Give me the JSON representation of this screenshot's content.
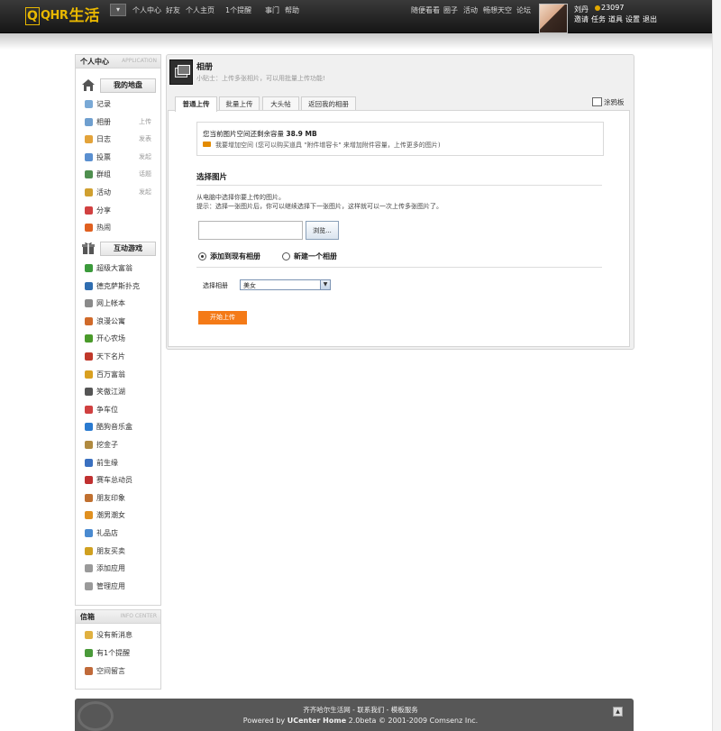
{
  "header": {
    "logo": {
      "q": "Q",
      "qhr": "QHR",
      "cn": "生活"
    },
    "menu_toggle": "▾",
    "nav_left": [
      "个人中心",
      "好友",
      "个人主页",
      "1个提醒",
      "事门",
      "帮助"
    ],
    "nav_right": [
      "随便看看",
      "圈子",
      "活动",
      "畅想天空",
      "论坛"
    ],
    "user": {
      "name": "刘丹",
      "points": "23097",
      "links": [
        "邀请",
        "任务",
        "道具",
        "设置",
        "退出"
      ]
    }
  },
  "sidebar": {
    "title": "个人中心",
    "subtitle": "APPLICATION",
    "section_mine": "我的地盘",
    "items": [
      {
        "label": "记录",
        "action": "",
        "icon": "record-icon",
        "color": "#7aa9d6"
      },
      {
        "label": "相册",
        "action": "上传",
        "icon": "album-icon",
        "color": "#6f9fcf"
      },
      {
        "label": "日志",
        "action": "发表",
        "icon": "blog-icon",
        "color": "#e3a33a"
      },
      {
        "label": "投票",
        "action": "发起",
        "icon": "poll-icon",
        "color": "#5a8fd0"
      },
      {
        "label": "群组",
        "action": "话题",
        "icon": "group-icon",
        "color": "#4f8f4f"
      },
      {
        "label": "活动",
        "action": "发起",
        "icon": "event-icon",
        "color": "#d0a030"
      },
      {
        "label": "分享",
        "action": "",
        "icon": "share-icon",
        "color": "#d14040"
      },
      {
        "label": "热闹",
        "action": "",
        "icon": "hot-icon",
        "color": "#e06020"
      }
    ],
    "section_games": "互动游戏",
    "games": [
      {
        "label": "超级大富翁",
        "icon": "monopoly-icon",
        "color": "#3b9a3b"
      },
      {
        "label": "德克萨斯扑克",
        "icon": "poker-icon",
        "color": "#2f6db0"
      },
      {
        "label": "网上帐本",
        "icon": "ledger-icon",
        "color": "#8a8a8a"
      },
      {
        "label": "浪漫公寓",
        "icon": "apartment-icon",
        "color": "#d06a2a"
      },
      {
        "label": "开心农场",
        "icon": "farm-icon",
        "color": "#4a9a2a"
      },
      {
        "label": "天下名片",
        "icon": "card-icon",
        "color": "#c0382a"
      },
      {
        "label": "百万富翁",
        "icon": "millionaire-icon",
        "color": "#d9a020"
      },
      {
        "label": "笑傲江湖",
        "icon": "sword-icon",
        "color": "#555555"
      },
      {
        "label": "争车位",
        "icon": "parking-icon",
        "color": "#d04040"
      },
      {
        "label": "酷狗音乐盒",
        "icon": "music-icon",
        "color": "#2a7ad0"
      },
      {
        "label": "挖金子",
        "icon": "gold-icon",
        "color": "#b08a40"
      },
      {
        "label": "前生缘",
        "icon": "fate-icon",
        "color": "#3a70c0"
      },
      {
        "label": "赛车总动员",
        "icon": "racing-icon",
        "color": "#c03030"
      },
      {
        "label": "朋友印象",
        "icon": "impression-icon",
        "color": "#c07030"
      },
      {
        "label": "潮男潮女",
        "icon": "fashion-icon",
        "color": "#e09020"
      },
      {
        "label": "礼品店",
        "icon": "gift-shop-icon",
        "color": "#4a8ad0"
      },
      {
        "label": "朋友买卖",
        "icon": "trade-icon",
        "color": "#d0a020"
      },
      {
        "label": "添加应用",
        "icon": "add-app-icon",
        "color": "#9a9a9a"
      },
      {
        "label": "管理应用",
        "icon": "manage-app-icon",
        "color": "#9a9a9a"
      }
    ]
  },
  "inbox": {
    "title": "信箱",
    "subtitle": "INFO CENTER",
    "items": [
      {
        "label": "没有新消息",
        "icon": "mail-icon",
        "color": "#e0b040"
      },
      {
        "label": "有1个提醒",
        "icon": "notice-icon",
        "color": "#4a9a3a"
      },
      {
        "label": "空间留言",
        "icon": "guestbook-icon",
        "color": "#c06a3a"
      }
    ]
  },
  "main": {
    "title": "相册",
    "tip": "小贴士：上传多张相片，可以用批量上传功能!",
    "tabs": [
      "普通上传",
      "批量上传",
      "大头帖",
      "返回我的相册"
    ],
    "graffiti": "涂鸦板",
    "quota_prefix": "您当前图片空间还剩余容量",
    "quota_value": "38.9 MB",
    "quota_more_link": "我要增加空间",
    "quota_more_note": "(您可以购买道具 \"附件增容卡\" 来增加附件容量，上传更多的图片)",
    "select_title": "选择图片",
    "select_desc": "从电脑中选择你要上传的图片。",
    "select_hint": "提示：选择一张图片后，你可以继续选择下一张图片，这样就可以一次上传多张图片了。",
    "browse": "浏览...",
    "radio_existing": "添加到现有相册",
    "radio_new": "新建一个相册",
    "album_label": "选择相册",
    "album_value": "美女",
    "upload_button": "开始上传"
  },
  "footer": {
    "links": "齐齐哈尔生活网 - 联系我们 - 模板服务",
    "credit_prefix": "Powered by",
    "credit_brand": "UCenter Home",
    "credit_suffix": "2.0beta © 2001-2009 Comsenz Inc."
  },
  "colors": {
    "accent": "#f47a17",
    "brand": "#e9b800",
    "topbar": "#1e1e1e"
  }
}
